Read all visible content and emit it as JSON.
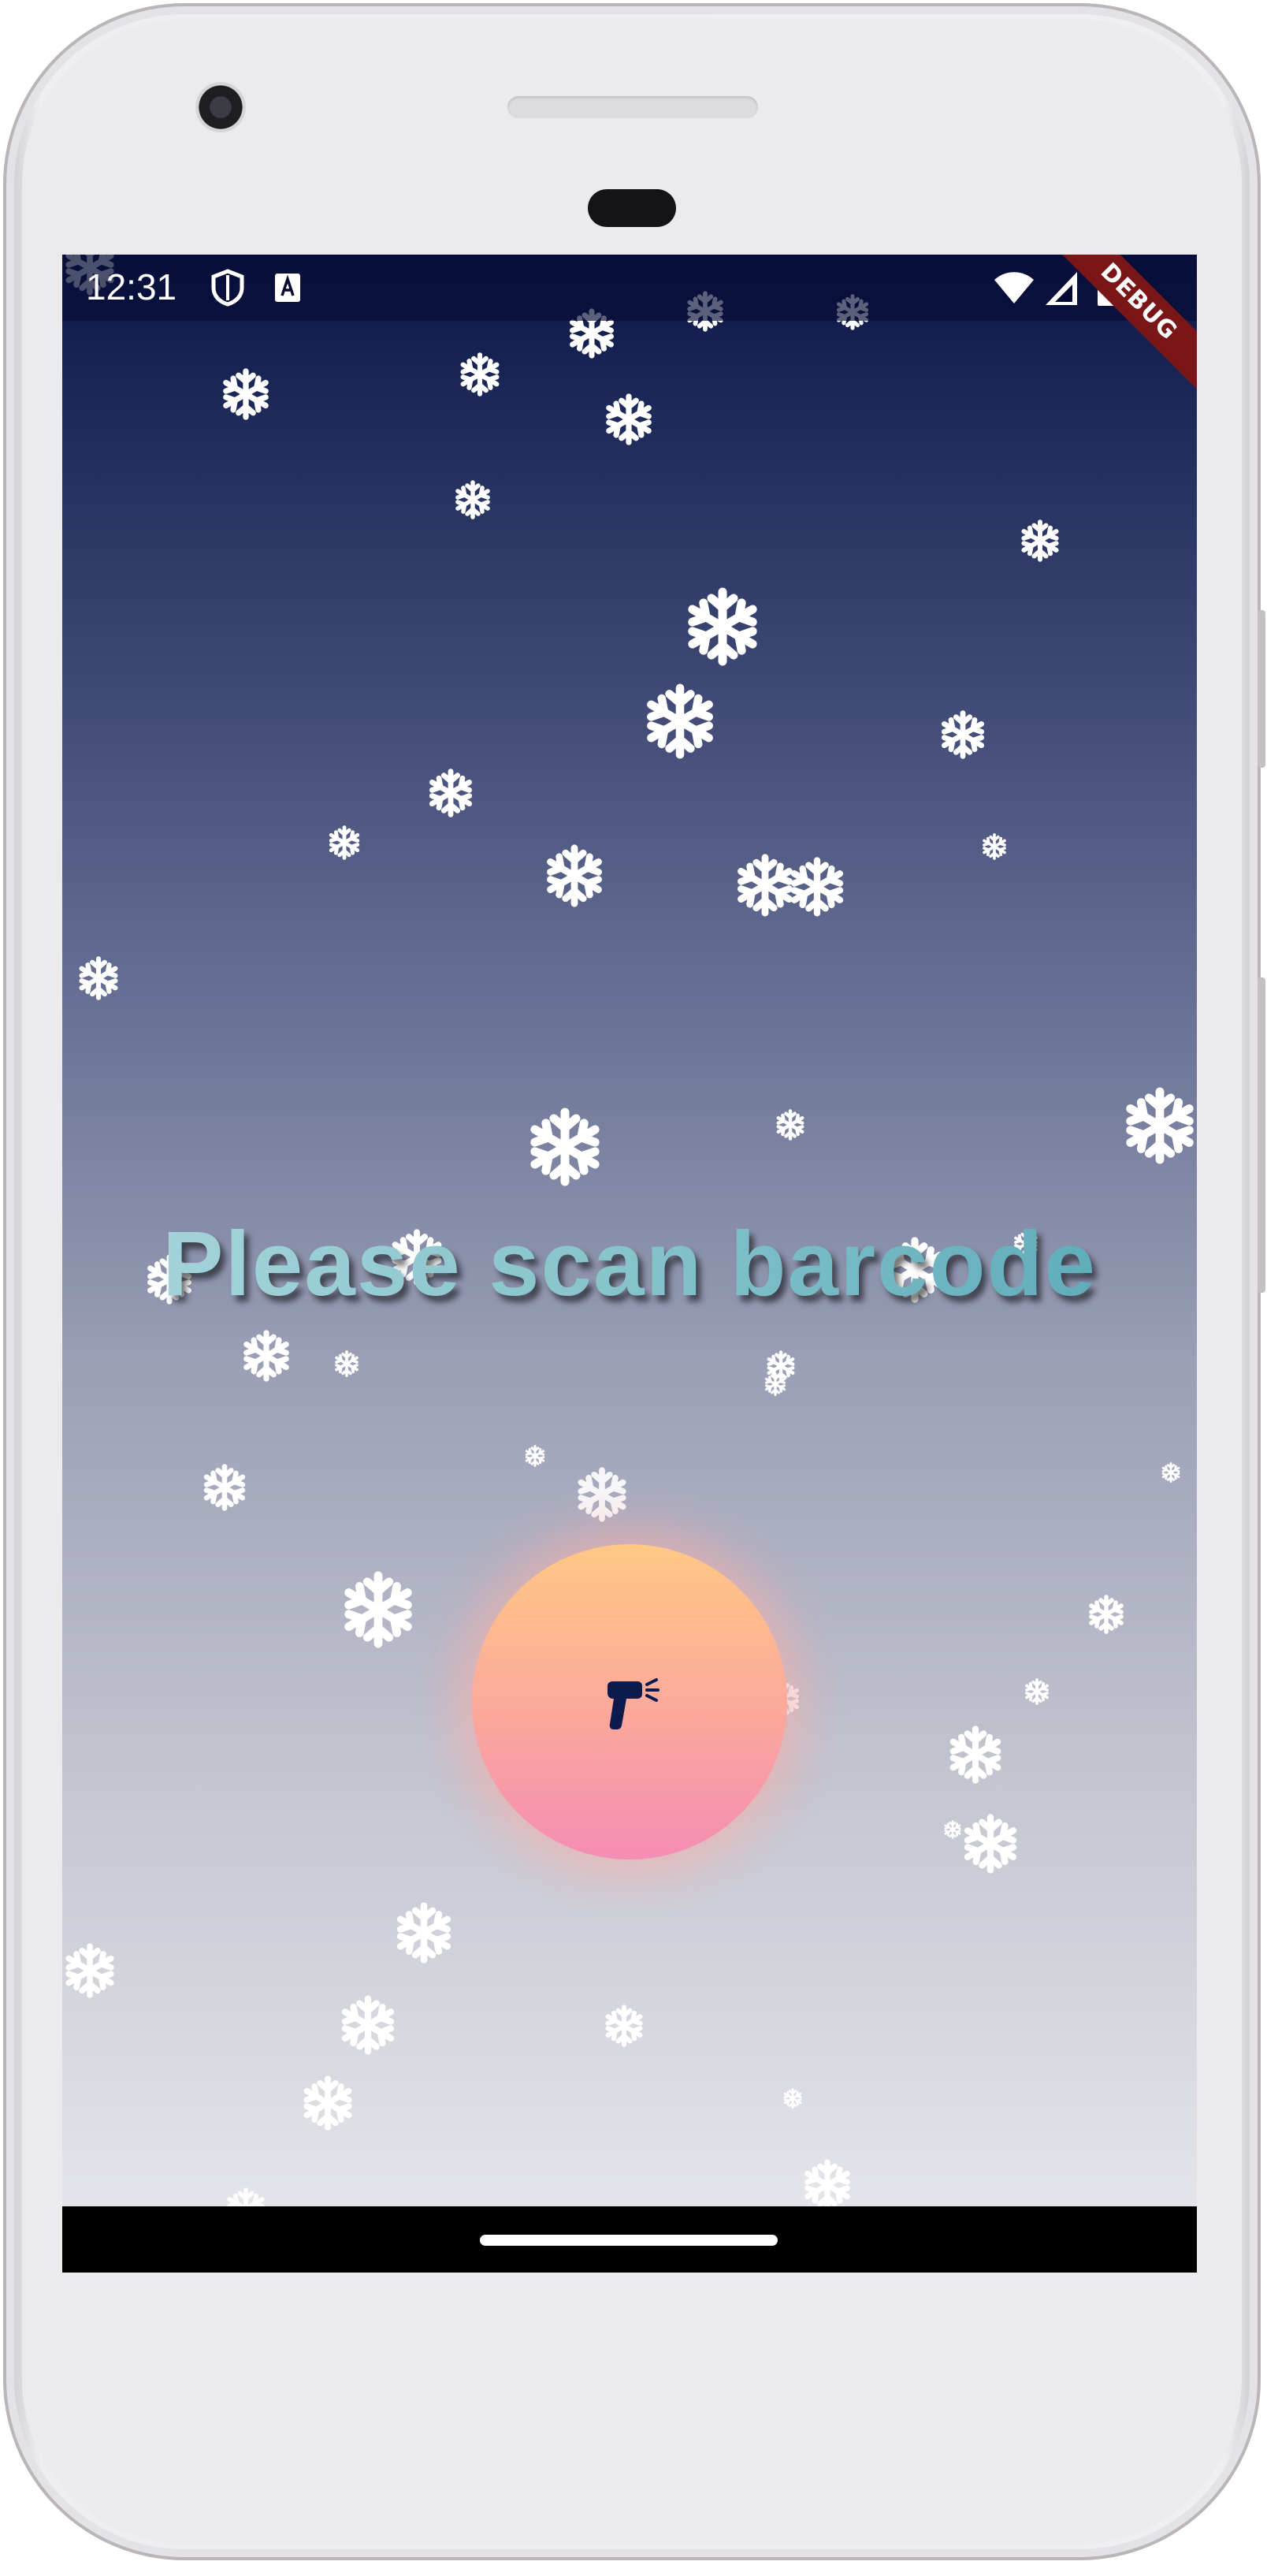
{
  "status_bar": {
    "time": "12:31",
    "icons": [
      "shield-icon",
      "a-notification-icon",
      "wifi-icon",
      "signal-icon",
      "battery-icon"
    ]
  },
  "debug_banner": "DEBUG",
  "main": {
    "headline": "Please scan barcode",
    "scan_button_icon": "barcode-scanner-icon"
  },
  "colors": {
    "background_top": "#0c1647",
    "background_bottom": "#e9eaee",
    "headline_start": "#a9d6dd",
    "headline_end": "#58a9b7",
    "button_top": "#ffc885",
    "button_bottom": "#f48db3",
    "debug_banner": "#7a1518"
  }
}
